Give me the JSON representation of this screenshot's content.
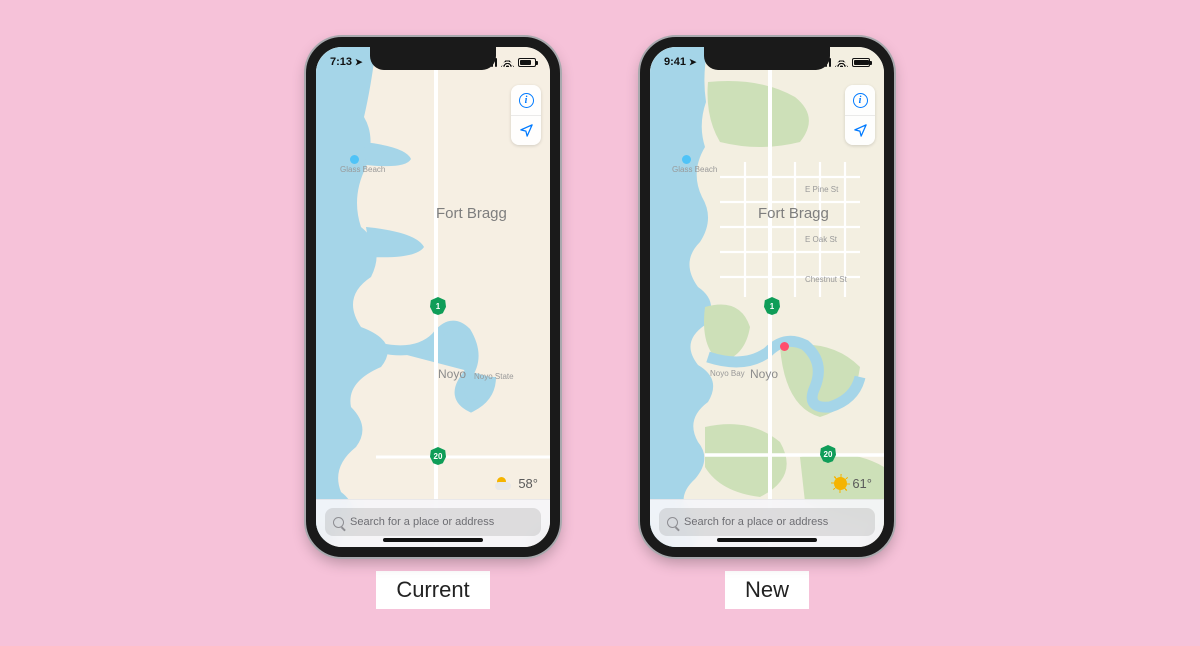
{
  "phones": {
    "current": {
      "caption": "Current",
      "status_time": "7:13",
      "search_placeholder": "Search for a place or address",
      "weather_temp": "58°",
      "weather_icon": "partly-cloudy",
      "labels": {
        "city1": "Fort Bragg",
        "noyo": "Noyo",
        "glass_beach": "Glass Beach",
        "noyo_state": "Noyo State"
      },
      "shields": {
        "hwy1": "1",
        "hwy20": "20"
      }
    },
    "new": {
      "caption": "New",
      "status_time": "9:41",
      "search_placeholder": "Search for a place or address",
      "weather_temp": "61°",
      "weather_icon": "sunny",
      "labels": {
        "city1": "Fort Bragg",
        "noyo": "Noyo",
        "glass_beach": "Glass Beach",
        "noyo_bay": "Noyo Bay",
        "pine_st": "E Pine St",
        "oak_st": "E Oak St",
        "chestnut_st": "Chestnut St"
      },
      "shields": {
        "hwy1": "1",
        "hwy20": "20"
      }
    }
  },
  "controls": {
    "info_glyph": "i"
  },
  "colors": {
    "water": "#a5d5e8",
    "land_current": "#f6efe3",
    "land_new": "#f3efe1",
    "park": "#cde0b8",
    "road": "#ffffff",
    "accent": "#007aff"
  }
}
